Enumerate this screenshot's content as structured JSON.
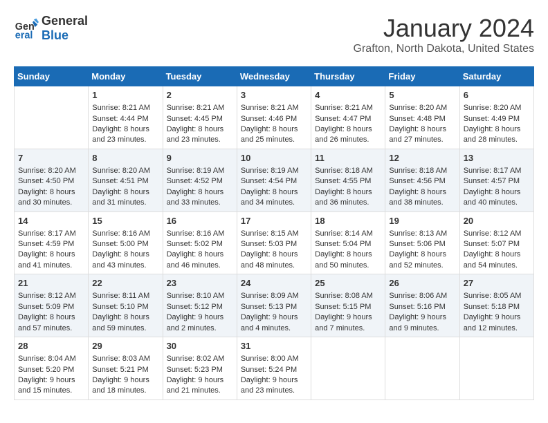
{
  "header": {
    "logo_line1": "General",
    "logo_line2": "Blue",
    "month_title": "January 2024",
    "location": "Grafton, North Dakota, United States"
  },
  "days_of_week": [
    "Sunday",
    "Monday",
    "Tuesday",
    "Wednesday",
    "Thursday",
    "Friday",
    "Saturday"
  ],
  "weeks": [
    [
      {
        "day": "",
        "data": ""
      },
      {
        "day": "1",
        "data": "Sunrise: 8:21 AM\nSunset: 4:44 PM\nDaylight: 8 hours\nand 23 minutes."
      },
      {
        "day": "2",
        "data": "Sunrise: 8:21 AM\nSunset: 4:45 PM\nDaylight: 8 hours\nand 23 minutes."
      },
      {
        "day": "3",
        "data": "Sunrise: 8:21 AM\nSunset: 4:46 PM\nDaylight: 8 hours\nand 25 minutes."
      },
      {
        "day": "4",
        "data": "Sunrise: 8:21 AM\nSunset: 4:47 PM\nDaylight: 8 hours\nand 26 minutes."
      },
      {
        "day": "5",
        "data": "Sunrise: 8:20 AM\nSunset: 4:48 PM\nDaylight: 8 hours\nand 27 minutes."
      },
      {
        "day": "6",
        "data": "Sunrise: 8:20 AM\nSunset: 4:49 PM\nDaylight: 8 hours\nand 28 minutes."
      }
    ],
    [
      {
        "day": "7",
        "data": "Sunrise: 8:20 AM\nSunset: 4:50 PM\nDaylight: 8 hours\nand 30 minutes."
      },
      {
        "day": "8",
        "data": "Sunrise: 8:20 AM\nSunset: 4:51 PM\nDaylight: 8 hours\nand 31 minutes."
      },
      {
        "day": "9",
        "data": "Sunrise: 8:19 AM\nSunset: 4:52 PM\nDaylight: 8 hours\nand 33 minutes."
      },
      {
        "day": "10",
        "data": "Sunrise: 8:19 AM\nSunset: 4:54 PM\nDaylight: 8 hours\nand 34 minutes."
      },
      {
        "day": "11",
        "data": "Sunrise: 8:18 AM\nSunset: 4:55 PM\nDaylight: 8 hours\nand 36 minutes."
      },
      {
        "day": "12",
        "data": "Sunrise: 8:18 AM\nSunset: 4:56 PM\nDaylight: 8 hours\nand 38 minutes."
      },
      {
        "day": "13",
        "data": "Sunrise: 8:17 AM\nSunset: 4:57 PM\nDaylight: 8 hours\nand 40 minutes."
      }
    ],
    [
      {
        "day": "14",
        "data": "Sunrise: 8:17 AM\nSunset: 4:59 PM\nDaylight: 8 hours\nand 41 minutes."
      },
      {
        "day": "15",
        "data": "Sunrise: 8:16 AM\nSunset: 5:00 PM\nDaylight: 8 hours\nand 43 minutes."
      },
      {
        "day": "16",
        "data": "Sunrise: 8:16 AM\nSunset: 5:02 PM\nDaylight: 8 hours\nand 46 minutes."
      },
      {
        "day": "17",
        "data": "Sunrise: 8:15 AM\nSunset: 5:03 PM\nDaylight: 8 hours\nand 48 minutes."
      },
      {
        "day": "18",
        "data": "Sunrise: 8:14 AM\nSunset: 5:04 PM\nDaylight: 8 hours\nand 50 minutes."
      },
      {
        "day": "19",
        "data": "Sunrise: 8:13 AM\nSunset: 5:06 PM\nDaylight: 8 hours\nand 52 minutes."
      },
      {
        "day": "20",
        "data": "Sunrise: 8:12 AM\nSunset: 5:07 PM\nDaylight: 8 hours\nand 54 minutes."
      }
    ],
    [
      {
        "day": "21",
        "data": "Sunrise: 8:12 AM\nSunset: 5:09 PM\nDaylight: 8 hours\nand 57 minutes."
      },
      {
        "day": "22",
        "data": "Sunrise: 8:11 AM\nSunset: 5:10 PM\nDaylight: 8 hours\nand 59 minutes."
      },
      {
        "day": "23",
        "data": "Sunrise: 8:10 AM\nSunset: 5:12 PM\nDaylight: 9 hours\nand 2 minutes."
      },
      {
        "day": "24",
        "data": "Sunrise: 8:09 AM\nSunset: 5:13 PM\nDaylight: 9 hours\nand 4 minutes."
      },
      {
        "day": "25",
        "data": "Sunrise: 8:08 AM\nSunset: 5:15 PM\nDaylight: 9 hours\nand 7 minutes."
      },
      {
        "day": "26",
        "data": "Sunrise: 8:06 AM\nSunset: 5:16 PM\nDaylight: 9 hours\nand 9 minutes."
      },
      {
        "day": "27",
        "data": "Sunrise: 8:05 AM\nSunset: 5:18 PM\nDaylight: 9 hours\nand 12 minutes."
      }
    ],
    [
      {
        "day": "28",
        "data": "Sunrise: 8:04 AM\nSunset: 5:20 PM\nDaylight: 9 hours\nand 15 minutes."
      },
      {
        "day": "29",
        "data": "Sunrise: 8:03 AM\nSunset: 5:21 PM\nDaylight: 9 hours\nand 18 minutes."
      },
      {
        "day": "30",
        "data": "Sunrise: 8:02 AM\nSunset: 5:23 PM\nDaylight: 9 hours\nand 21 minutes."
      },
      {
        "day": "31",
        "data": "Sunrise: 8:00 AM\nSunset: 5:24 PM\nDaylight: 9 hours\nand 23 minutes."
      },
      {
        "day": "",
        "data": ""
      },
      {
        "day": "",
        "data": ""
      },
      {
        "day": "",
        "data": ""
      }
    ]
  ]
}
